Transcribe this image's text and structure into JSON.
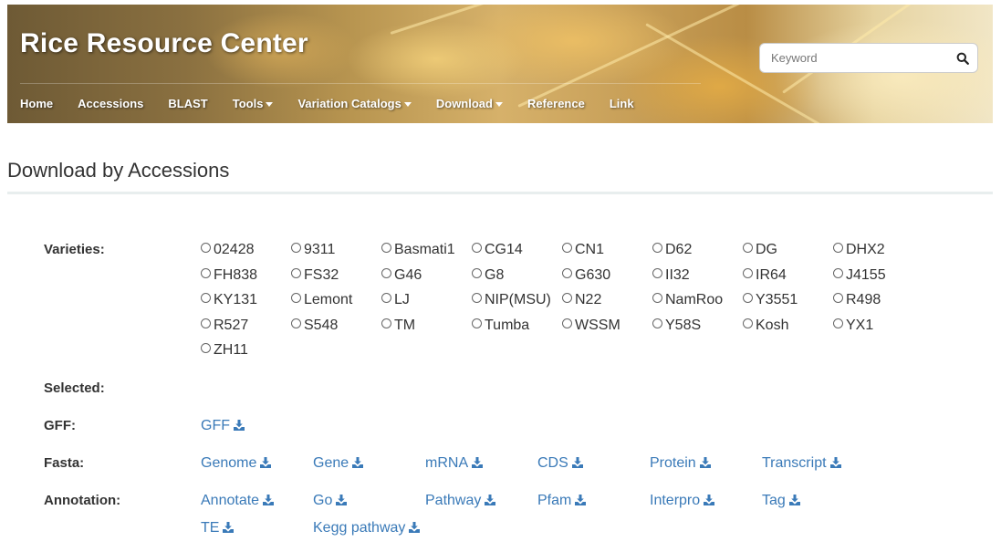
{
  "header": {
    "site_title": "Rice Resource Center",
    "search_placeholder": "Keyword",
    "nav": [
      {
        "label": "Home",
        "dropdown": false
      },
      {
        "label": "Accessions",
        "dropdown": false
      },
      {
        "label": "BLAST",
        "dropdown": false
      },
      {
        "label": "Tools",
        "dropdown": true
      },
      {
        "label": "Variation Catalogs",
        "dropdown": true
      },
      {
        "label": "Download",
        "dropdown": true
      },
      {
        "label": "Reference",
        "dropdown": false
      },
      {
        "label": "Link",
        "dropdown": false
      }
    ]
  },
  "main": {
    "title": "Download by Accessions",
    "labels": {
      "varieties": "Varieties:",
      "selected": "Selected:",
      "gff": "GFF:",
      "fasta": "Fasta:",
      "annotation": "Annotation:"
    },
    "varieties": [
      "02428",
      "9311",
      "Basmati1",
      "CG14",
      "CN1",
      "D62",
      "DG",
      "DHX2",
      "FH838",
      "FS32",
      "G46",
      "G8",
      "G630",
      "II32",
      "IR64",
      "J4155",
      "KY131",
      "Lemont",
      "LJ",
      "NIP(MSU)",
      "N22",
      "NamRoo",
      "Y3551",
      "R498",
      "R527",
      "S548",
      "TM",
      "Tumba",
      "WSSM",
      "Y58S",
      "Kosh",
      "YX1",
      "ZH11"
    ],
    "selected_value": "",
    "gff_links": [
      "GFF"
    ],
    "fasta_links": [
      "Genome",
      "Gene",
      "mRNA",
      "CDS",
      "Protein",
      "Transcript"
    ],
    "annotation_links": [
      "Annotate",
      "Go",
      "Pathway",
      "Pfam",
      "Interpro",
      "Tag",
      "TE",
      "Kegg pathway"
    ]
  },
  "colors": {
    "link": "#3a7ab8",
    "text": "#333333"
  },
  "icons": {
    "search": "search-icon",
    "download": "download-icon",
    "radio": "radio-icon"
  }
}
